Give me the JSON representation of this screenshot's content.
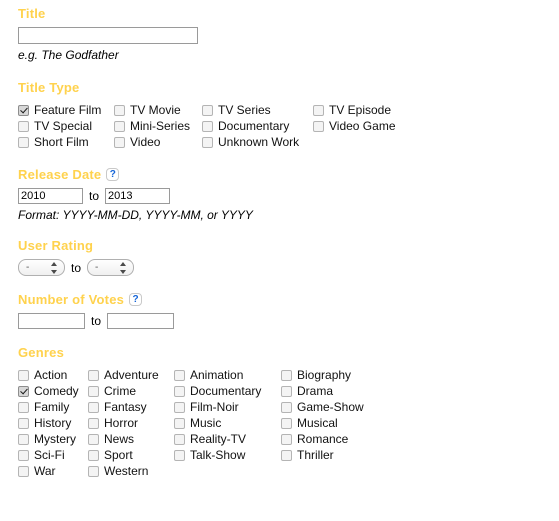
{
  "form": {
    "title_section": {
      "heading": "Title",
      "input_value": "",
      "input_placeholder": "",
      "hint": "e.g. The Godfather"
    },
    "title_type_section": {
      "heading": "Title Type",
      "options": [
        {
          "label": "Feature Film",
          "checked": true
        },
        {
          "label": "TV Movie",
          "checked": false
        },
        {
          "label": "TV Series",
          "checked": false
        },
        {
          "label": "TV Episode",
          "checked": false
        },
        {
          "label": "TV Special",
          "checked": false
        },
        {
          "label": "Mini-Series",
          "checked": false
        },
        {
          "label": "Documentary",
          "checked": false
        },
        {
          "label": "Video Game",
          "checked": false
        },
        {
          "label": "Short Film",
          "checked": false
        },
        {
          "label": "Video",
          "checked": false
        },
        {
          "label": "Unknown Work",
          "checked": false
        }
      ]
    },
    "release_date_section": {
      "heading": "Release Date",
      "help_icon": "question-mark-icon",
      "help_glyph": "?",
      "from_value": "2010",
      "to_label": "to",
      "to_value": "2013",
      "format_hint": "Format: YYYY-MM-DD, YYYY-MM, or YYYY"
    },
    "user_rating_section": {
      "heading": "User Rating",
      "from_value": "-",
      "to_label": "to",
      "to_value": "-"
    },
    "votes_section": {
      "heading": "Number of Votes",
      "help_icon": "question-mark-icon",
      "help_glyph": "?",
      "from_value": "",
      "to_label": "to",
      "to_value": ""
    },
    "genres_section": {
      "heading": "Genres",
      "options": [
        {
          "label": "Action",
          "checked": false
        },
        {
          "label": "Adventure",
          "checked": false
        },
        {
          "label": "Animation",
          "checked": false
        },
        {
          "label": "Biography",
          "checked": false
        },
        {
          "label": "Comedy",
          "checked": true
        },
        {
          "label": "Crime",
          "checked": false
        },
        {
          "label": "Documentary",
          "checked": false
        },
        {
          "label": "Drama",
          "checked": false
        },
        {
          "label": "Family",
          "checked": false
        },
        {
          "label": "Fantasy",
          "checked": false
        },
        {
          "label": "Film-Noir",
          "checked": false
        },
        {
          "label": "Game-Show",
          "checked": false
        },
        {
          "label": "History",
          "checked": false
        },
        {
          "label": "Horror",
          "checked": false
        },
        {
          "label": "Music",
          "checked": false
        },
        {
          "label": "Musical",
          "checked": false
        },
        {
          "label": "Mystery",
          "checked": false
        },
        {
          "label": "News",
          "checked": false
        },
        {
          "label": "Reality-TV",
          "checked": false
        },
        {
          "label": "Romance",
          "checked": false
        },
        {
          "label": "Sci-Fi",
          "checked": false
        },
        {
          "label": "Sport",
          "checked": false
        },
        {
          "label": "Talk-Show",
          "checked": false
        },
        {
          "label": "Thriller",
          "checked": false
        },
        {
          "label": "War",
          "checked": false
        },
        {
          "label": "Western",
          "checked": false
        }
      ]
    }
  },
  "colors": {
    "heading": "#FFD24D",
    "help": "#1565D8",
    "background": "#FFFFFF",
    "text": "#121212"
  }
}
